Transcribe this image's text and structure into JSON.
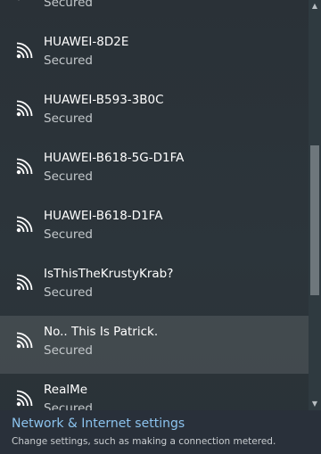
{
  "network_list": {
    "items": [
      {
        "ssid": "",
        "status": "Secured",
        "icon": "wifi-signal-icon"
      },
      {
        "ssid": "HUAWEI-8D2E",
        "status": "Secured",
        "icon": "wifi-signal-icon"
      },
      {
        "ssid": "HUAWEI-B593-3B0C",
        "status": "Secured",
        "icon": "wifi-signal-icon"
      },
      {
        "ssid": "HUAWEI-B618-5G-D1FA",
        "status": "Secured",
        "icon": "wifi-signal-icon"
      },
      {
        "ssid": "HUAWEI-B618-D1FA",
        "status": "Secured",
        "icon": "wifi-signal-icon"
      },
      {
        "ssid": "IsThisTheKrustyKrab?",
        "status": "Secured",
        "icon": "wifi-signal-icon"
      },
      {
        "ssid": "No.. This Is Patrick.",
        "status": "Secured",
        "icon": "wifi-signal-icon"
      },
      {
        "ssid": "RealMe",
        "status": "Secured",
        "icon": "wifi-signal-icon"
      }
    ],
    "hovered_index": 6
  },
  "footer": {
    "settings_link": "Network & Internet settings",
    "settings_description": "Change settings, such as making a connection metered."
  },
  "scrollbar": {
    "up_arrow": "▲",
    "down_arrow": "▼"
  },
  "colors": {
    "background": "#2b3339",
    "hover": "#3d454a",
    "link": "#8cc3ee",
    "secondary_text": "#c4c9cc",
    "scroll_thumb": "#6e777c"
  }
}
